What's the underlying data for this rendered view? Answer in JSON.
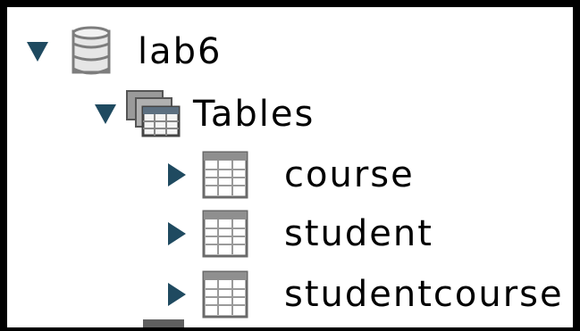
{
  "tree": {
    "database": {
      "label": "lab6",
      "expanded": true,
      "icon": "database-icon"
    },
    "tables_folder": {
      "label": "Tables",
      "expanded": true,
      "icon": "tables-folder-icon"
    },
    "tables": [
      {
        "label": "course",
        "expanded": false,
        "icon": "table-icon"
      },
      {
        "label": "student",
        "expanded": false,
        "icon": "table-icon"
      },
      {
        "label": "studentcourse",
        "expanded": false,
        "icon": "table-icon"
      }
    ]
  },
  "colors": {
    "arrow": "#1f4a60",
    "icon_gray": "#8a8a8a",
    "text": "#000000",
    "border": "#000000"
  }
}
